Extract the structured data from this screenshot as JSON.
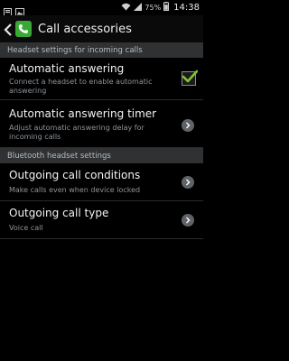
{
  "status_bar": {
    "battery_percent": "75%",
    "time": "14:38",
    "icons": [
      "notification-icon",
      "image-icon",
      "wifi-icon",
      "signal-icon",
      "battery-icon"
    ]
  },
  "header": {
    "title": "Call accessories",
    "back_icon": "back-icon",
    "app_icon": "phone-icon"
  },
  "sections": {
    "headset": "Headset settings for incoming calls",
    "bluetooth": "Bluetooth headset settings"
  },
  "items": [
    {
      "title": "Automatic answering",
      "subtitle": "Connect a headset to enable automatic answering",
      "control": "checkbox",
      "checked": true
    },
    {
      "title": "Automatic answering timer",
      "subtitle": "Adjust automatic answering delay for incoming calls",
      "control": "chevron"
    },
    {
      "title": "Outgoing call conditions",
      "subtitle": "Make calls even when device locked",
      "control": "chevron"
    },
    {
      "title": "Outgoing call type",
      "subtitle": "Voice call",
      "control": "chevron"
    }
  ],
  "colors": {
    "accent_check": "#7dc72f",
    "section_bg": "#2f3133",
    "app_icon_bg": "#3aa835"
  }
}
